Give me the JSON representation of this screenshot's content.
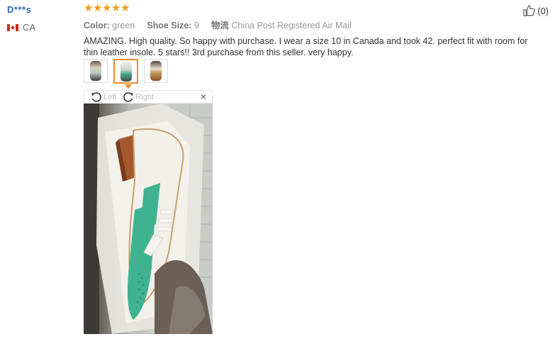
{
  "reviewer": {
    "name": "D***s",
    "country": "CA"
  },
  "review": {
    "stars": [
      "★",
      "★",
      "★",
      "★",
      "★"
    ],
    "rating": 5,
    "color_label": "Color:",
    "color_value": "green",
    "size_label": "Shoe Size:",
    "size_value": "9",
    "shipping_label": "物流",
    "shipping_value": "China Post Registered Air Mail",
    "text": "AMAZING. High quality. So happy with purchase. I wear a size 10 in Canada and took 42. perfect fit with room for thin leather insole. 5 stars!! 3rd purchase from this seller. very happy."
  },
  "helpful": {
    "count": "(0)",
    "icon": "thumbs-up-icon"
  },
  "gallery": {
    "thumbnails": 3,
    "active_index": 1,
    "rotate_left_label": "Left",
    "rotate_right_label": "Right",
    "close_label": "×"
  },
  "colors": {
    "username": "#2b6ab8",
    "stars": "#f19b15",
    "active_thumb_border": "#f38b22"
  }
}
